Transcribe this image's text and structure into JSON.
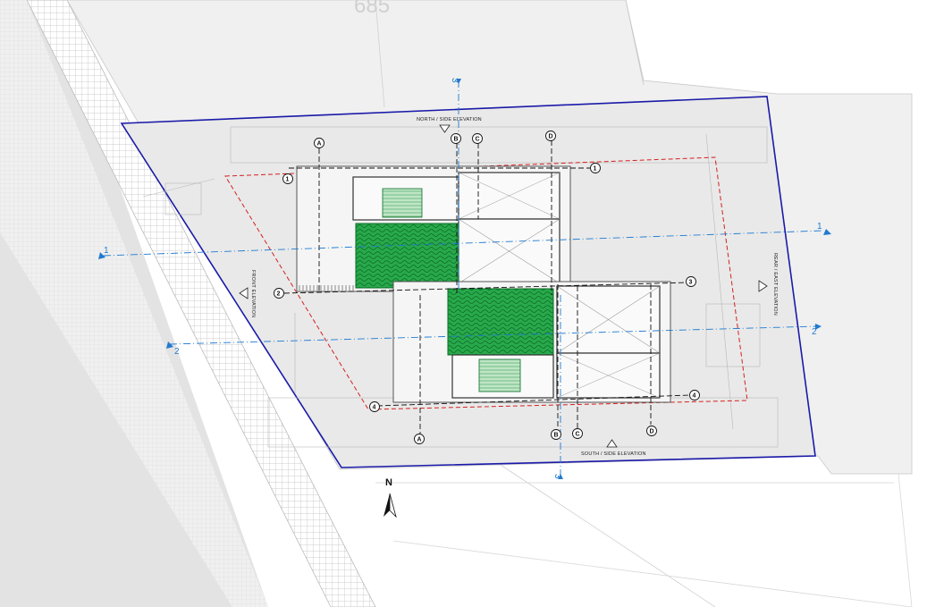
{
  "lot_number": "685",
  "north_label": "N",
  "elevations": {
    "north": "NORTH / SIDE ELEVATION",
    "south": "SOUTH / SIDE ELEVATION",
    "front": "FRONT ELEVATION",
    "rear": "REAR / EAST ELEVATION"
  },
  "section_markers": {
    "s1_left": "1",
    "s1_right": "1",
    "s2_left": "2",
    "s2_right": "2",
    "s3_top": "3",
    "s3_bottom": "3"
  },
  "grid_bubbles": {
    "A_top": "A",
    "B_top": "B",
    "C_top": "C",
    "D_top": "D",
    "A_bottom": "A",
    "B_bottom": "B",
    "C_bottom": "C",
    "D_bottom": "D",
    "row_1": "1",
    "row_2": "2",
    "row_3": "3",
    "row_4": "4"
  },
  "colors": {
    "property_line": "#1a1aa8",
    "setback_line": "#d42020",
    "section_line": "#1f7ad1",
    "roof_green": "#22a84a",
    "site_fill": "#ececec",
    "street_grid": "#cfcfcf"
  }
}
